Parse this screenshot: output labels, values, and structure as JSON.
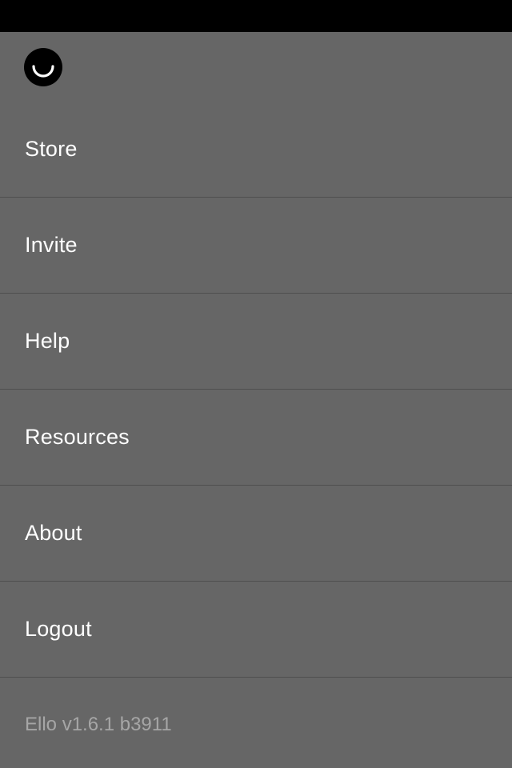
{
  "app": {
    "logo_icon": "ello-smile-logo-icon"
  },
  "colors": {
    "background": "#666666",
    "status_bar": "#000000",
    "divider": "#4f4f4f",
    "text": "#ffffff",
    "muted_text": "#a6a6a6"
  },
  "menu": {
    "items": [
      {
        "label": "Store"
      },
      {
        "label": "Invite"
      },
      {
        "label": "Help"
      },
      {
        "label": "Resources"
      },
      {
        "label": "About"
      },
      {
        "label": "Logout"
      }
    ]
  },
  "footer": {
    "version": "Ello v1.6.1 b3911"
  }
}
